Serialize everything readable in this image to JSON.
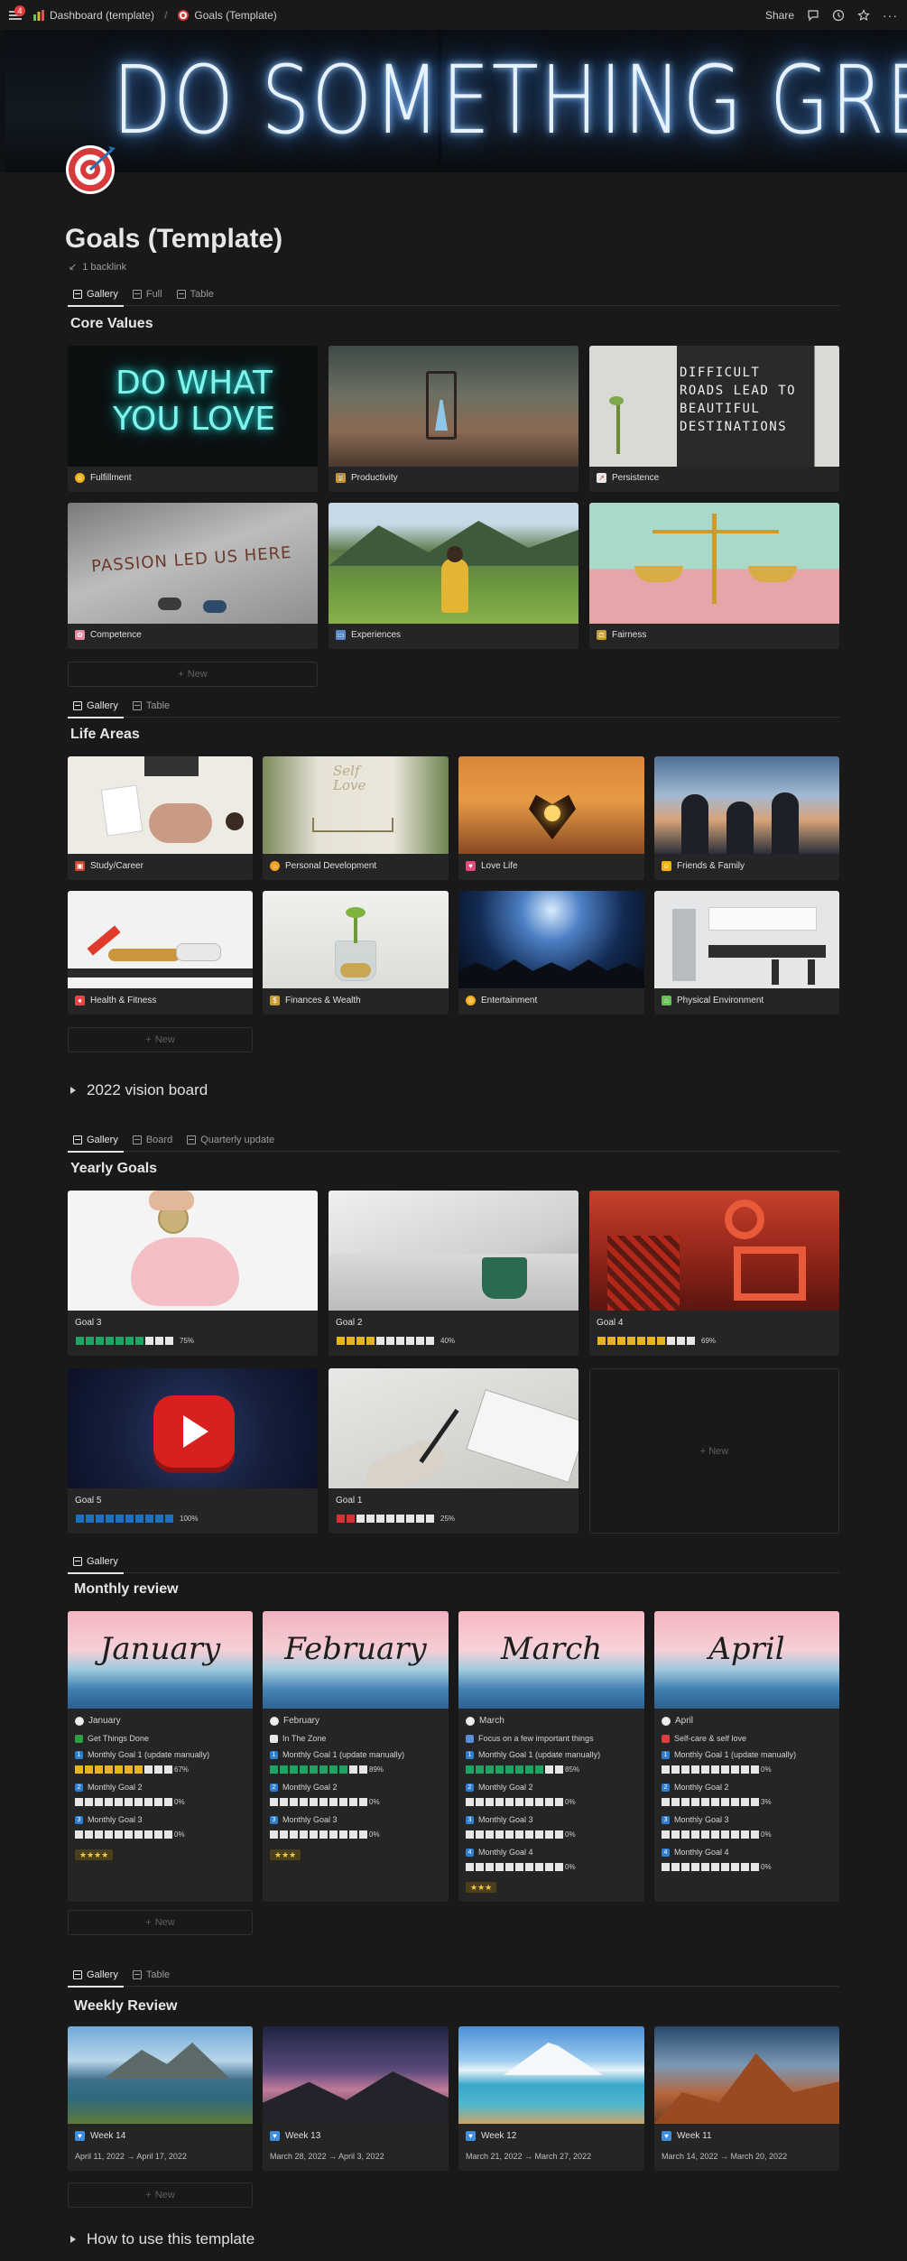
{
  "topbar": {
    "notif_count": "4",
    "crumb1": "Dashboard (template)",
    "crumb2": "Goals (Template)",
    "share": "Share"
  },
  "cover_text": "DO SOMETHING GREAT",
  "page": {
    "title": "Goals (Template)",
    "backlinks": "1 backlink"
  },
  "core_values": {
    "tabs": [
      "Gallery",
      "Full",
      "Table"
    ],
    "title": "Core Values",
    "cards": [
      {
        "label": "Fulfillment",
        "icon": "grin-emoji",
        "image_text": "DO WHAT YOU LOVE"
      },
      {
        "label": "Productivity",
        "icon": "hourglass-emoji"
      },
      {
        "label": "Persistence",
        "icon": "chart-emoji",
        "image_text": "DIFFICULT ROADS LEAD TO BEAUTIFUL DESTINATIONS"
      },
      {
        "label": "Competence",
        "icon": "brain-emoji",
        "image_text": "PASSION LED US HERE"
      },
      {
        "label": "Experiences",
        "icon": "card-emoji"
      },
      {
        "label": "Fairness",
        "icon": "scales-emoji"
      }
    ],
    "new_label": "New"
  },
  "life_areas": {
    "tabs": [
      "Gallery",
      "Table"
    ],
    "title": "Life Areas",
    "cards": [
      {
        "label": "Study/Career",
        "icon": "backpack-emoji"
      },
      {
        "label": "Personal Development",
        "icon": "sun-emoji",
        "image_text": "Self Love"
      },
      {
        "label": "Love Life",
        "icon": "heart-emoji"
      },
      {
        "label": "Friends & Family",
        "icon": "people-emoji"
      },
      {
        "label": "Health & Fitness",
        "icon": "pill-emoji"
      },
      {
        "label": "Finances & Wealth",
        "icon": "moneybag-emoji"
      },
      {
        "label": "Entertainment",
        "icon": "smile-emoji"
      },
      {
        "label": "Physical Environment",
        "icon": "house-emoji"
      }
    ],
    "new_label": "New"
  },
  "vision_board": "2022 vision board",
  "yearly": {
    "tabs": [
      "Gallery",
      "Board",
      "Quarterly update"
    ],
    "title": "Yearly Goals",
    "cards": [
      {
        "label": "Goal 3",
        "percent": "75%",
        "filled": 7,
        "color": "#1fa463"
      },
      {
        "label": "Goal 2",
        "percent": "40%",
        "filled": 4,
        "color": "#e6b422"
      },
      {
        "label": "Goal 4",
        "percent": "69%",
        "filled": 7,
        "color": "#e6b422"
      },
      {
        "label": "Goal 5",
        "percent": "100%",
        "filled": 10,
        "color": "#1f6fc0"
      },
      {
        "label": "Goal 1",
        "percent": "25%",
        "filled": 2,
        "color": "#d03535"
      }
    ],
    "new_label": "New"
  },
  "monthly": {
    "tabs": [
      "Gallery"
    ],
    "title": "Monthly review",
    "cards": [
      {
        "month": "January",
        "focus": "Get Things Done",
        "goals": [
          {
            "n": "1",
            "label": "Monthly Goal 1 (update manually)",
            "percent": "67%",
            "filled": 7,
            "color": "#e6b422"
          },
          {
            "n": "2",
            "label": "Monthly Goal 2",
            "percent": "0%",
            "filled": 0,
            "color": "#e6e6e6"
          },
          {
            "n": "3",
            "label": "Monthly Goal 3",
            "percent": "0%",
            "filled": 0,
            "color": "#e6e6e6"
          }
        ],
        "stars": "★★★★"
      },
      {
        "month": "February",
        "focus": "In The Zone",
        "goals": [
          {
            "n": "1",
            "label": "Monthly Goal 1 (update manually)",
            "percent": "89%",
            "filled": 8,
            "color": "#1fa463"
          },
          {
            "n": "2",
            "label": "Monthly Goal 2",
            "percent": "0%",
            "filled": 0,
            "color": "#e6e6e6"
          },
          {
            "n": "3",
            "label": "Monthly Goal 3",
            "percent": "0%",
            "filled": 0,
            "color": "#e6e6e6"
          }
        ],
        "stars": "★★★"
      },
      {
        "month": "March",
        "focus": "Focus on a few important things",
        "goals": [
          {
            "n": "1",
            "label": "Monthly Goal 1 (update manually)",
            "percent": "85%",
            "filled": 8,
            "color": "#1fa463"
          },
          {
            "n": "2",
            "label": "Monthly Goal 2",
            "percent": "0%",
            "filled": 0,
            "color": "#e6e6e6"
          },
          {
            "n": "3",
            "label": "Monthly Goal 3",
            "percent": "0%",
            "filled": 0,
            "color": "#e6e6e6"
          },
          {
            "n": "4",
            "label": "Monthly Goal 4",
            "percent": "0%",
            "filled": 0,
            "color": "#e6e6e6"
          }
        ],
        "stars": "★★★"
      },
      {
        "month": "April",
        "focus": "Self-care & self love",
        "goals": [
          {
            "n": "1",
            "label": "Monthly Goal 1 (update manually)",
            "percent": "0%",
            "filled": 0,
            "color": "#e6e6e6"
          },
          {
            "n": "2",
            "label": "Monthly Goal 2",
            "percent": "3%",
            "filled": 0,
            "color": "#e6e6e6"
          },
          {
            "n": "3",
            "label": "Monthly Goal 3",
            "percent": "0%",
            "filled": 0,
            "color": "#e6e6e6"
          },
          {
            "n": "4",
            "label": "Monthly Goal 4",
            "percent": "0%",
            "filled": 0,
            "color": "#e6e6e6"
          }
        ],
        "stars": ""
      }
    ],
    "new_label": "New"
  },
  "weekly": {
    "tabs": [
      "Gallery",
      "Table"
    ],
    "title": "Weekly Review",
    "cards": [
      {
        "label": "Week 14",
        "dates": "April 11, 2022 → April 17, 2022"
      },
      {
        "label": "Week 13",
        "dates": "March 28, 2022 → April 3, 2022"
      },
      {
        "label": "Week 12",
        "dates": "March 21, 2022 → March 27, 2022"
      },
      {
        "label": "Week 11",
        "dates": "March 14, 2022 → March 20, 2022"
      }
    ],
    "new_label": "New"
  },
  "how_to_use": "How to use this template"
}
